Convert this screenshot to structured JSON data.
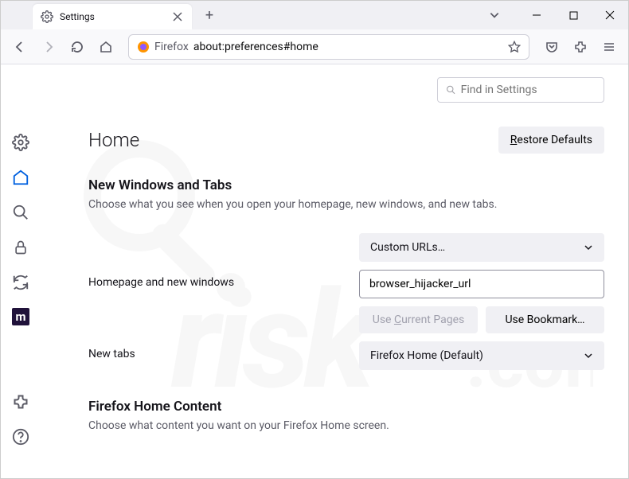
{
  "tab": {
    "title": "Settings"
  },
  "urlbar": {
    "prefix": "Firefox",
    "url": "about:preferences#home"
  },
  "search": {
    "placeholder": "Find in Settings"
  },
  "page": {
    "title": "Home"
  },
  "buttons": {
    "restore": "Restore Defaults",
    "use_current": "Use Current Pages",
    "use_bookmark": "Use Bookmark…"
  },
  "sections": {
    "nwt": {
      "title": "New Windows and Tabs",
      "sub": "Choose what you see when you open your homepage, new windows, and new tabs."
    },
    "fhc": {
      "title": "Firefox Home Content",
      "sub": "Choose what content you want on your Firefox Home screen."
    }
  },
  "form": {
    "homepage_label": "Homepage and new windows",
    "homepage_select": "Custom URLs…",
    "homepage_url": "browser_hijacker_url",
    "newtabs_label": "New tabs",
    "newtabs_select": "Firefox Home (Default)"
  }
}
